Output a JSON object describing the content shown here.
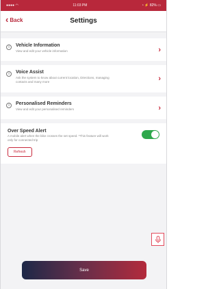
{
  "status_bar": {
    "left": "●●●● ◠",
    "center": "11:03 PM",
    "right": "◔ ⚡ 82% ▭"
  },
  "header": {
    "back_label": "Back",
    "title": "Settings"
  },
  "settings": [
    {
      "title": "Vehicle Information",
      "subtitle": "View and edit your vehicle information"
    },
    {
      "title": "Voice Assist",
      "subtitle": "Ask the system to know about current location, Directions, managing contacts and many more"
    },
    {
      "title": "Personalised Reminders",
      "subtitle": "View and edit your personalised reminders"
    }
  ],
  "speed_alert": {
    "title": "Over Speed Alert",
    "subtitle": "A mobile alert when the bike crosses the set speed. *This feature will work only for connected trip",
    "button_label": "Refresh",
    "enabled": true
  },
  "save_label": "Save",
  "colors": {
    "accent": "#b8283b",
    "toggle_on": "#2ea84c"
  }
}
